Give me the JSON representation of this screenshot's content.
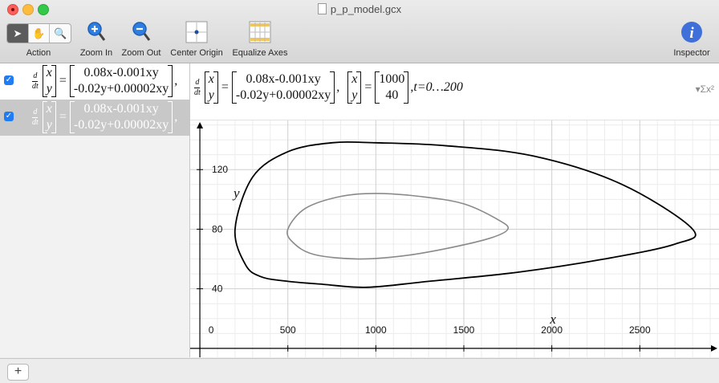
{
  "window": {
    "title": "p_p_model.gcx"
  },
  "toolbar": {
    "action_label": "Action",
    "zoom_in_label": "Zoom In",
    "zoom_out_label": "Zoom Out",
    "center_origin_label": "Center Origin",
    "equalize_axes_label": "Equalize Axes",
    "inspector_label": "Inspector"
  },
  "equations": {
    "deriv_num": "d",
    "deriv_den": "dt",
    "var_x": "x",
    "var_y": "y",
    "rhs_top": "0.08x-0.001xy",
    "rhs_bottom": "-0.02y+0.00002xy",
    "init_x": "1000",
    "init_y": "40",
    "t_range": "t=0…200",
    "equals": "=",
    "comma": ","
  },
  "sidebar_rows": [
    {
      "checked": true,
      "selected": false
    },
    {
      "checked": true,
      "selected": true
    }
  ],
  "graph": {
    "x_label": "x",
    "y_label": "y",
    "x_ticks": [
      "0",
      "500",
      "1000",
      "1500",
      "2000",
      "2500"
    ],
    "y_ticks": [
      "40",
      "80",
      "120"
    ]
  },
  "chart_data": {
    "type": "line",
    "title": "",
    "xlabel": "x",
    "ylabel": "y",
    "xlim": [
      -55,
      2950
    ],
    "ylim": [
      -6,
      153
    ],
    "grid": true,
    "series": [
      {
        "color": "#000000",
        "x": [
          200,
          300,
          500,
          750,
          1000,
          1400,
          1900,
          2400,
          2800,
          2700,
          2300,
          1800,
          1300,
          950,
          700,
          500,
          350,
          260,
          200
        ],
        "y": [
          80,
          115,
          132,
          138,
          138,
          136,
          129,
          110,
          80,
          70,
          60,
          51,
          45,
          41,
          43,
          45,
          48,
          56,
          80
        ]
      },
      {
        "color": "#8a8a8a",
        "x": [
          500,
          600,
          800,
          1000,
          1250,
          1500,
          1700,
          1750,
          1650,
          1400,
          1150,
          900,
          650,
          530,
          500
        ],
        "y": [
          80,
          94,
          102,
          104,
          102,
          97,
          86,
          80,
          74,
          67,
          62,
          60,
          63,
          71,
          80
        ]
      }
    ],
    "colors": {
      "outer": "#000000",
      "inner": "#8a8a8a"
    }
  },
  "bottom": {
    "add_label": "+"
  },
  "icons": {
    "arrow": "arrow-cursor-icon",
    "hand": "hand-icon",
    "magnifier": "magnifier-icon",
    "zoom_in": "zoom-in-icon",
    "zoom_out": "zoom-out-icon",
    "center_origin": "center-origin-icon",
    "equalize": "equalize-axes-icon",
    "inspector": "info-icon",
    "sigma": "sigma-icon",
    "checkbox": "checkmark-icon"
  }
}
